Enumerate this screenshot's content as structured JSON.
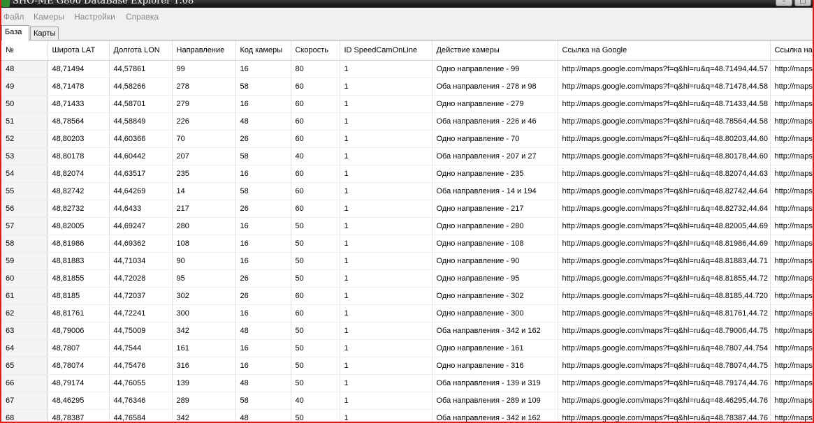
{
  "window": {
    "title": "SHO-ME G800 DataBase Explorer 1.08"
  },
  "menu": [
    "Файл",
    "Камеры",
    "Настройки",
    "Справка"
  ],
  "tabs": [
    "База",
    "Карты"
  ],
  "table": {
    "headers": [
      "№",
      "Широта LAT",
      "Долгота LON",
      "Направление",
      "Код камеры",
      "Скорость",
      "ID SpeedCamOnLine",
      "Действие камеры",
      "Ссылка на Google",
      "Ссылка на"
    ],
    "rows": [
      [
        "48",
        "48,71494",
        "44,57861",
        "99",
        "16",
        "80",
        "1",
        "Одно направление - 99",
        "http://maps.google.com/maps?f=q&hl=ru&q=48.71494,44.57",
        "http://maps"
      ],
      [
        "49",
        "48,71478",
        "44,58266",
        "278",
        "58",
        "60",
        "1",
        "Оба направления - 278 и 98",
        "http://maps.google.com/maps?f=q&hl=ru&q=48.71478,44.58",
        "http://maps"
      ],
      [
        "50",
        "48,71433",
        "44,58701",
        "279",
        "16",
        "60",
        "1",
        "Одно направление - 279",
        "http://maps.google.com/maps?f=q&hl=ru&q=48.71433,44.58",
        "http://maps"
      ],
      [
        "51",
        "48,78564",
        "44,58849",
        "226",
        "48",
        "60",
        "1",
        "Оба направления - 226 и 46",
        "http://maps.google.com/maps?f=q&hl=ru&q=48.78564,44.58",
        "http://maps"
      ],
      [
        "52",
        "48,80203",
        "44,60366",
        "70",
        "26",
        "60",
        "1",
        "Одно направление - 70",
        "http://maps.google.com/maps?f=q&hl=ru&q=48.80203,44.60",
        "http://maps"
      ],
      [
        "53",
        "48,80178",
        "44,60442",
        "207",
        "58",
        "40",
        "1",
        "Оба направления - 207 и 27",
        "http://maps.google.com/maps?f=q&hl=ru&q=48.80178,44.60",
        "http://maps"
      ],
      [
        "54",
        "48,82074",
        "44,63517",
        "235",
        "16",
        "60",
        "1",
        "Одно направление - 235",
        "http://maps.google.com/maps?f=q&hl=ru&q=48.82074,44.63",
        "http://maps"
      ],
      [
        "55",
        "48,82742",
        "44,64269",
        "14",
        "58",
        "60",
        "1",
        "Оба направления - 14 и 194",
        "http://maps.google.com/maps?f=q&hl=ru&q=48.82742,44.64",
        "http://maps"
      ],
      [
        "56",
        "48,82732",
        "44,6433",
        "217",
        "26",
        "60",
        "1",
        "Одно направление - 217",
        "http://maps.google.com/maps?f=q&hl=ru&q=48.82732,44.64",
        "http://maps"
      ],
      [
        "57",
        "48,82005",
        "44,69247",
        "280",
        "16",
        "50",
        "1",
        "Одно направление - 280",
        "http://maps.google.com/maps?f=q&hl=ru&q=48.82005,44.69",
        "http://maps"
      ],
      [
        "58",
        "48,81986",
        "44,69362",
        "108",
        "16",
        "50",
        "1",
        "Одно направление - 108",
        "http://maps.google.com/maps?f=q&hl=ru&q=48.81986,44.69",
        "http://maps"
      ],
      [
        "59",
        "48,81883",
        "44,71034",
        "90",
        "16",
        "50",
        "1",
        "Одно направление - 90",
        "http://maps.google.com/maps?f=q&hl=ru&q=48.81883,44.71",
        "http://maps"
      ],
      [
        "60",
        "48,81855",
        "44,72028",
        "95",
        "26",
        "50",
        "1",
        "Одно направление - 95",
        "http://maps.google.com/maps?f=q&hl=ru&q=48.81855,44.72",
        "http://maps"
      ],
      [
        "61",
        "48,8185",
        "44,72037",
        "302",
        "26",
        "60",
        "1",
        "Одно направление - 302",
        "http://maps.google.com/maps?f=q&hl=ru&q=48.8185,44.720",
        "http://maps"
      ],
      [
        "62",
        "48,81761",
        "44,72241",
        "300",
        "16",
        "60",
        "1",
        "Одно направление - 300",
        "http://maps.google.com/maps?f=q&hl=ru&q=48.81761,44.72",
        "http://maps"
      ],
      [
        "63",
        "48,79006",
        "44,75009",
        "342",
        "48",
        "50",
        "1",
        "Оба направления - 342 и 162",
        "http://maps.google.com/maps?f=q&hl=ru&q=48.79006,44.75",
        "http://maps"
      ],
      [
        "64",
        "48,7807",
        "44,7544",
        "161",
        "16",
        "50",
        "1",
        "Одно направление - 161",
        "http://maps.google.com/maps?f=q&hl=ru&q=48.7807,44.754",
        "http://maps"
      ],
      [
        "65",
        "48,78074",
        "44,75476",
        "316",
        "16",
        "50",
        "1",
        "Одно направление - 316",
        "http://maps.google.com/maps?f=q&hl=ru&q=48.78074,44.75",
        "http://maps"
      ],
      [
        "66",
        "48,79174",
        "44,76055",
        "139",
        "48",
        "50",
        "1",
        "Оба направления - 139 и 319",
        "http://maps.google.com/maps?f=q&hl=ru&q=48.79174,44.76",
        "http://maps"
      ],
      [
        "67",
        "48,46295",
        "44,76346",
        "289",
        "58",
        "40",
        "1",
        "Оба направления - 289 и 109",
        "http://maps.google.com/maps?f=q&hl=ru&q=48.46295,44.76",
        "http://maps"
      ],
      [
        "68",
        "48,78387",
        "44,76584",
        "342",
        "48",
        "50",
        "1",
        "Оба направления - 342 и 162",
        "http://maps.google.com/maps?f=q&hl=ru&q=48.78387,44.76",
        "http://maps"
      ]
    ]
  }
}
